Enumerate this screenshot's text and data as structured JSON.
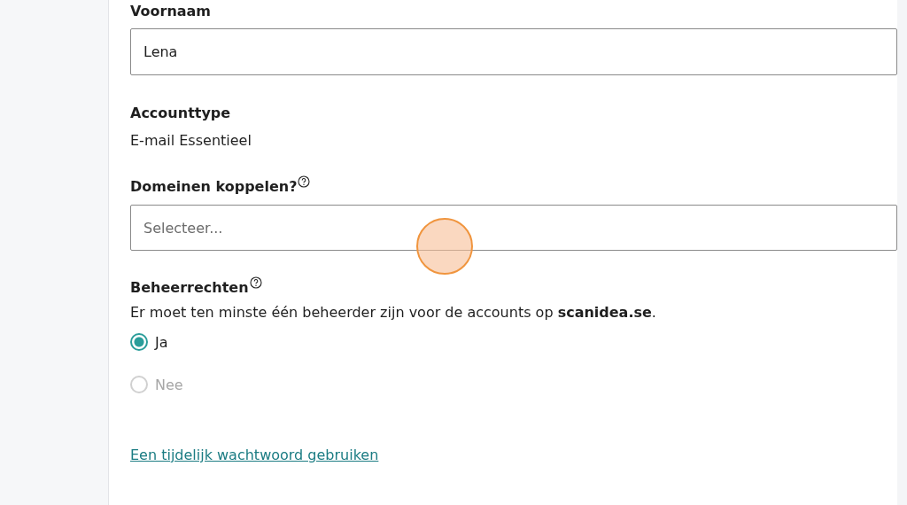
{
  "first_name": {
    "label": "Voornaam",
    "value": "Lena"
  },
  "account_type": {
    "label": "Accounttype",
    "value": "E-mail Essentieel"
  },
  "domains": {
    "label": "Domeinen koppelen?",
    "placeholder": "Selecteer..."
  },
  "admin_rights": {
    "label": "Beheerrechten",
    "note": "Er moet ten minste één beheerder zijn voor de accounts op **scanidea.se**.",
    "options": [
      {
        "label": "Ja",
        "selected": true,
        "disabled": false
      },
      {
        "label": "Nee",
        "selected": false,
        "disabled": true
      }
    ]
  },
  "temp_password_link": "Een tijdelijk wachtwoord gebruiken",
  "click_indicator": true
}
